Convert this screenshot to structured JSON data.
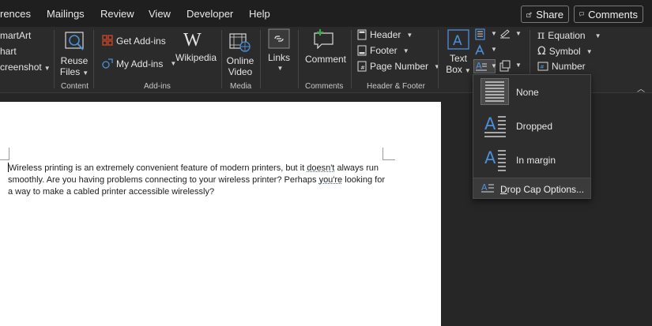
{
  "menubar": {
    "tabs": [
      "rences",
      "Mailings",
      "Review",
      "View",
      "Developer",
      "Help"
    ],
    "share_label": "Share",
    "comments_label": "Comments"
  },
  "ribbon": {
    "left_items": [
      "martArt",
      "hart",
      "creenshot"
    ],
    "content": {
      "reuse_files_line1": "Reuse",
      "reuse_files_line2": "Files",
      "group_label": "Content"
    },
    "addins": {
      "get_addins": "Get Add-ins",
      "my_addins": "My Add-ins",
      "wikipedia": "Wikipedia",
      "group_label": "Add-ins"
    },
    "media": {
      "online_video_line1": "Online",
      "online_video_line2": "Video",
      "group_label": "Media"
    },
    "links": {
      "label": "Links"
    },
    "comments": {
      "comment_label": "Comment",
      "group_label": "Comments"
    },
    "header_footer": {
      "header": "Header",
      "footer": "Footer",
      "page_number": "Page Number",
      "group_label": "Header & Footer"
    },
    "text": {
      "text_box_line1": "Text",
      "text_box_line2": "Box"
    },
    "symbols": {
      "equation": "Equation",
      "symbol": "Symbol",
      "number": "Number"
    }
  },
  "document": {
    "text_before_1": "Wireless printing is an extremely convenient feature of modern printers, but it ",
    "squiggle_1": "doesn't",
    "text_after_1": " always run smoothly. Are you having problems connecting to your wireless printer? Perhaps ",
    "squiggle_2": "you're",
    "text_after_2": " looking for a way to make a cabled printer accessible wirelessly?"
  },
  "drop_cap_menu": {
    "items": [
      {
        "label": "None",
        "icon": "drop-cap-none-icon"
      },
      {
        "label": "Dropped",
        "icon": "drop-cap-dropped-icon"
      },
      {
        "label": "In margin",
        "icon": "drop-cap-in-margin-icon"
      }
    ],
    "options_prefix": "D",
    "options_rest": "rop Cap Options..."
  },
  "colors": {
    "accent": "#4a90d9",
    "addins_red": "#d24726",
    "menu_bg": "#1f1f1f",
    "ribbon_bg": "#2b2b2b"
  }
}
